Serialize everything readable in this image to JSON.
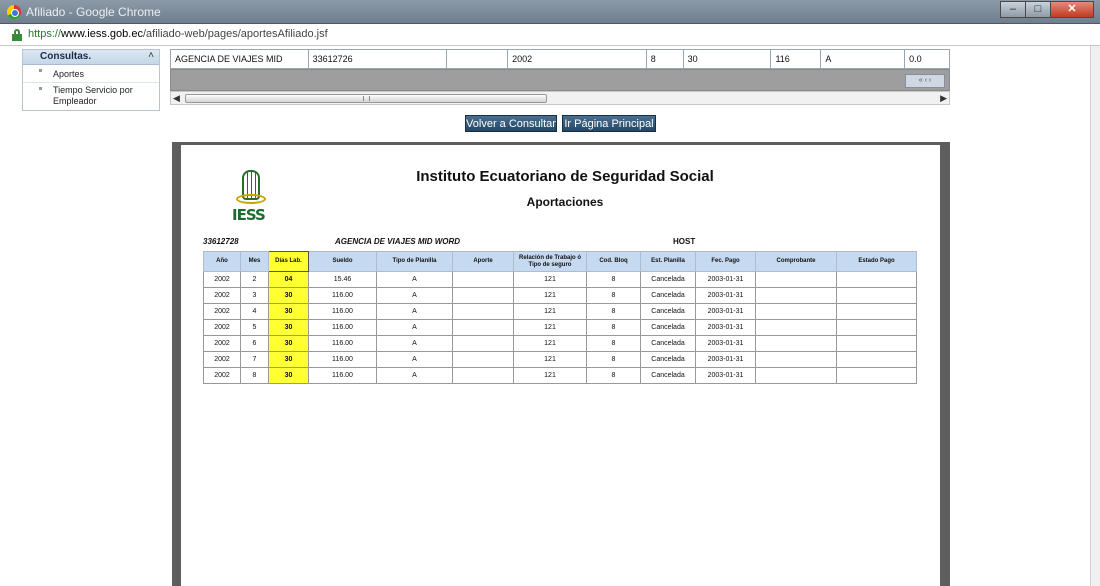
{
  "window": {
    "title": "Afiliado - Google Chrome",
    "minimize": "–",
    "maximize": "□",
    "close": "✕"
  },
  "address": {
    "scheme": "https://",
    "host": "www.iess.gob.ec",
    "path": "/afiliado-web/pages/aportesAfiliado.jsf"
  },
  "sidebar": {
    "header": "Consultas.",
    "items": [
      {
        "label": "Aportes"
      },
      {
        "label": "Tiempo Servicio por Empleador"
      }
    ]
  },
  "top_row": [
    "AGENCIA DE VIAJES MID WORD",
    "33612726",
    "",
    "2002",
    "8",
    "30",
    "116",
    "A",
    "0.0"
  ],
  "buttons": {
    "volver": "Volver a Consultar",
    "inicio": "Ir Página Principal"
  },
  "report": {
    "logo_text": "IESS",
    "title": "Instituto Ecuatoriano de Seguridad Social",
    "subtitle": "Aportaciones",
    "id_number": "33612728",
    "employer": "AGENCIA DE VIAJES MID WORD",
    "host": "HOST",
    "columns": [
      "Año",
      "Mes",
      "Días Lab.",
      "Sueldo",
      "Tipo de Planilla",
      "Aporte",
      "Relación de Trabajo ó Tipo de seguro",
      "Cod. Bloq",
      "Est. Planilla",
      "Fec. Pago",
      "Comprobante",
      "Estado Pago"
    ],
    "rows": [
      [
        "2002",
        "2",
        "04",
        "15.46",
        "A",
        "",
        "121",
        "8",
        "Cancelada",
        "2003-01-31",
        "",
        ""
      ],
      [
        "2002",
        "3",
        "30",
        "116.00",
        "A",
        "",
        "121",
        "8",
        "Cancelada",
        "2003-01-31",
        "",
        ""
      ],
      [
        "2002",
        "4",
        "30",
        "116.00",
        "A",
        "",
        "121",
        "8",
        "Cancelada",
        "2003-01-31",
        "",
        ""
      ],
      [
        "2002",
        "5",
        "30",
        "116.00",
        "A",
        "",
        "121",
        "8",
        "Cancelada",
        "2003-01-31",
        "",
        ""
      ],
      [
        "2002",
        "6",
        "30",
        "116.00",
        "A",
        "",
        "121",
        "8",
        "Cancelada",
        "2003-01-31",
        "",
        ""
      ],
      [
        "2002",
        "7",
        "30",
        "116.00",
        "A",
        "",
        "121",
        "8",
        "Cancelada",
        "2003-01-31",
        "",
        ""
      ],
      [
        "2002",
        "8",
        "30",
        "116.00",
        "A",
        "",
        "121",
        "8",
        "Cancelada",
        "2003-01-31",
        "",
        ""
      ]
    ]
  },
  "colors": {
    "highlight": "#ffff33",
    "header_bg": "#c5d9f1",
    "button_bg": "#244766"
  }
}
